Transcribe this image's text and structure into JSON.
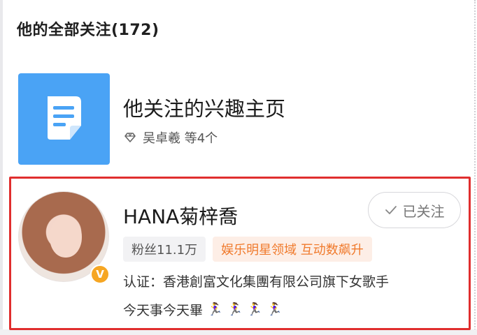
{
  "header": {
    "title": "他的全部关注(172)"
  },
  "interest": {
    "title": "他关注的兴趣主页",
    "icon": "document-icon",
    "sub_icon": "diamond-icon",
    "sub_text": "吴卓羲 等4个"
  },
  "user": {
    "name": "HANA菊梓喬",
    "verified_badge": "V",
    "follow_label": "已关注",
    "fans_label": "粉丝11.1万",
    "domain_tag": "娱乐明星领域 互动数飙升",
    "certification": "认证：香港創富文化集團有限公司旗下女歌手",
    "motto": "今天事今天畢",
    "motto_emojis": [
      "🏃‍♀️",
      "🏃‍♀️",
      "🏃‍♀️",
      "🏃‍♀️"
    ]
  },
  "colors": {
    "accent_blue": "#4aa3f5",
    "highlight_border": "#e02e2e",
    "domain_tag_text": "#f07a2c",
    "badge_gold": "#f6a623"
  }
}
